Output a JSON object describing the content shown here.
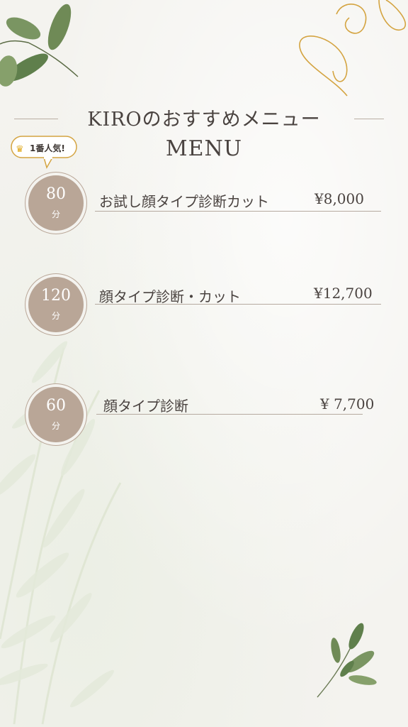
{
  "menu": {
    "title": "KIROのおすすめメニュー",
    "subtitle": "MENU",
    "badge": "1番人気!",
    "items": [
      {
        "duration": "80",
        "unit": "分",
        "name": "お試し顔タイプ診断カット",
        "price": "¥8,000"
      },
      {
        "duration": "120",
        "unit": "分",
        "name": "顔タイプ診断・カット",
        "price": "¥12,700"
      },
      {
        "duration": "60",
        "unit": "分",
        "name": "顔タイプ診断",
        "price": "¥ 7,700"
      }
    ]
  },
  "icons": {
    "crown": "crown-icon",
    "leaves_top": "leaf-branch-icon",
    "leaves_bottom": "leaf-sprig-icon",
    "gold_swirl": "gold-swirl-decoration"
  },
  "colors": {
    "circle": "#b9a697",
    "text": "#4a4340",
    "gold": "#d4a441",
    "leaf": "#5f7f4c"
  }
}
